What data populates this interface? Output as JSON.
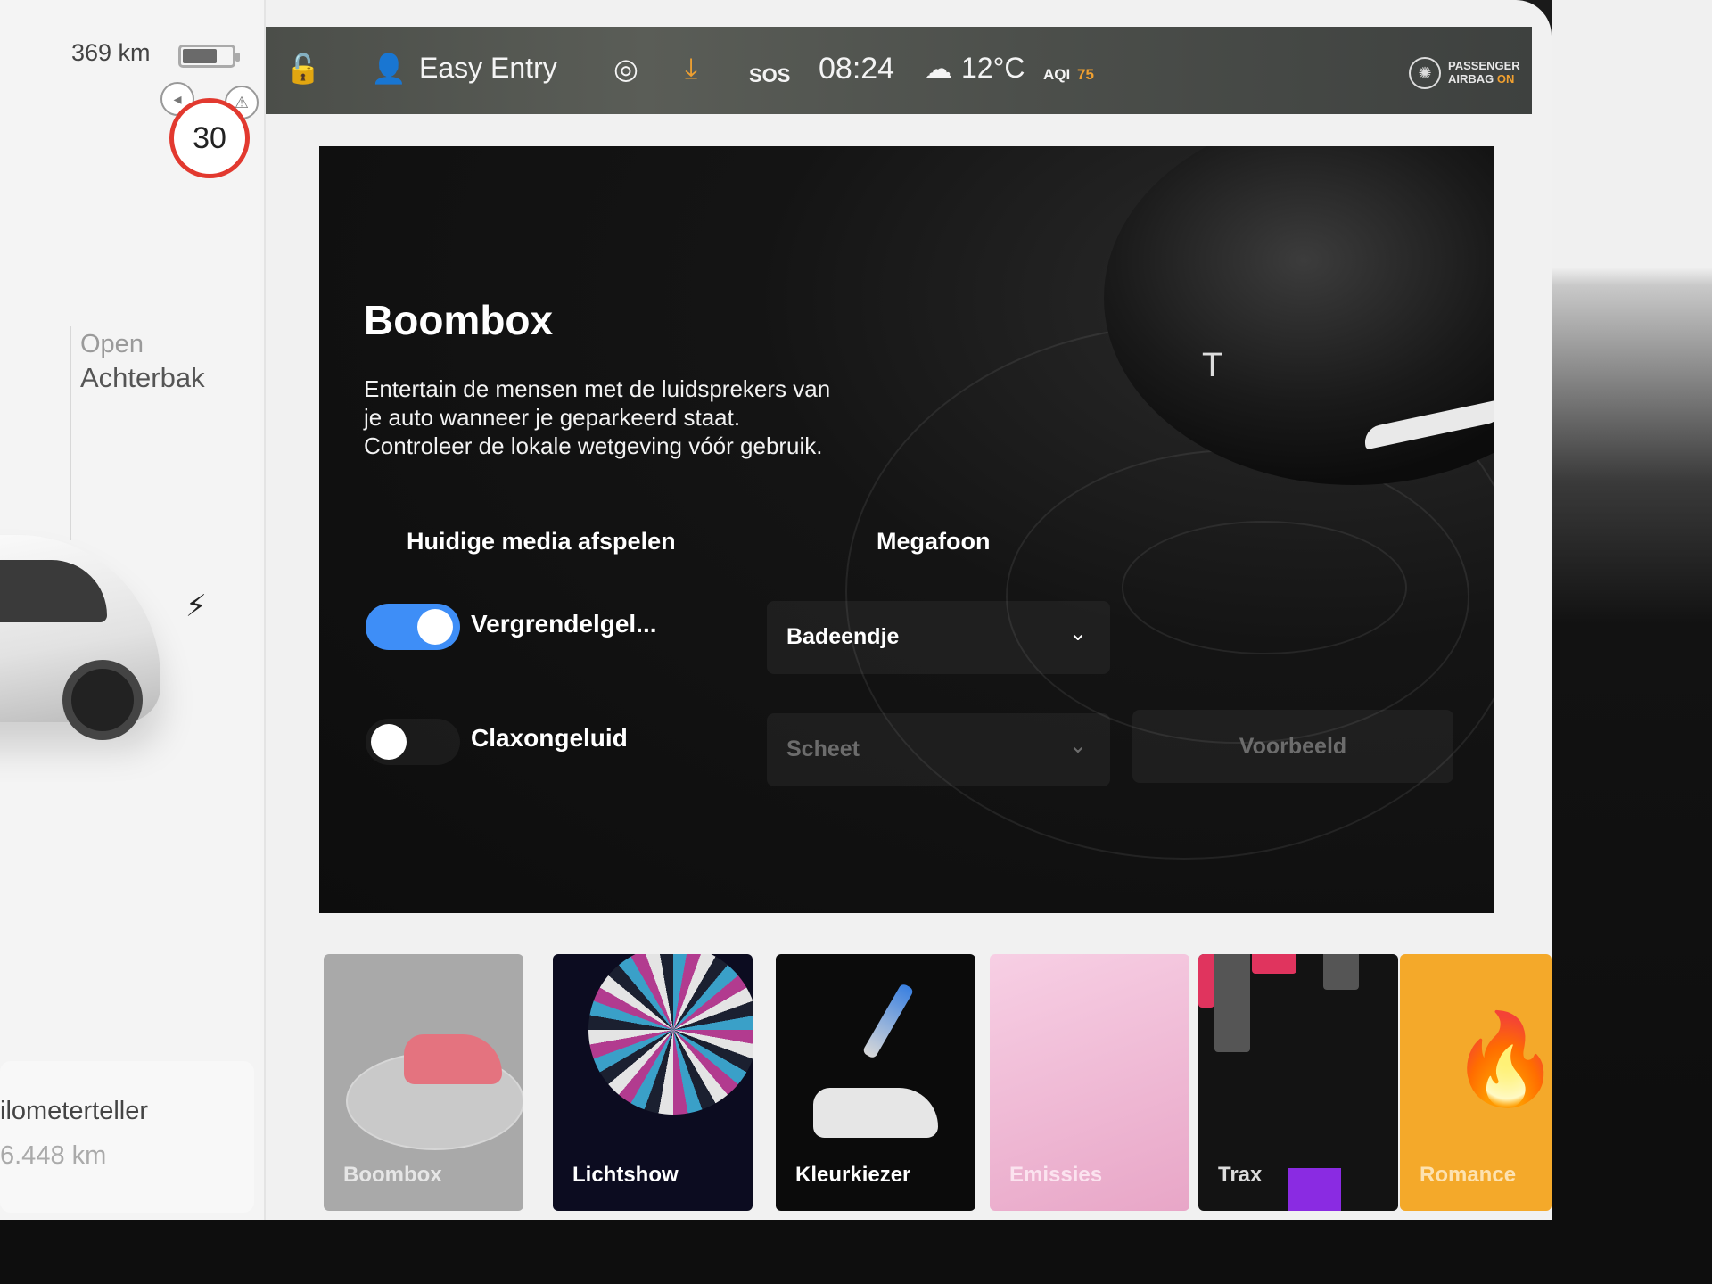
{
  "status": {
    "range": "369 km",
    "speed_limit": "30",
    "profile_name": "Easy Entry",
    "time": "08:24",
    "temperature": "12°C",
    "aqi_label": "AQI",
    "aqi_value": "75",
    "sos_label": "SOS",
    "airbag_line1": "PASSENGER",
    "airbag_line2": "AIRBAG",
    "airbag_state": "ON"
  },
  "car_pane": {
    "trunk_state": "Open",
    "trunk_name": "Achterbak",
    "odometer_label": "ilometerteller",
    "odometer_value": "6.448 km"
  },
  "boombox": {
    "title": "Boombox",
    "description_lines": [
      "Entertain de mensen met de luidsprekers van",
      "je auto wanneer je geparkeerd staat.",
      "Controleer de lokale wetgeving vóór gebruik."
    ],
    "tabs": [
      "Huidige media afspelen",
      "Megafoon"
    ],
    "lock_sound_label": "Vergrendelgel...",
    "lock_sound_enabled": true,
    "lock_sound_value": "Badeendje",
    "horn_sound_label": "Claxongeluid",
    "horn_sound_enabled": false,
    "horn_sound_value": "Scheet",
    "preview_label": "Voorbeeld"
  },
  "tiles": [
    "Boombox",
    "Lichtshow",
    "Kleurkiezer",
    "Emissies",
    "Trax",
    "Romance"
  ],
  "colors": {
    "accent": "#3e8ef7",
    "speed_sign_red": "#e2392f",
    "aqi_amber": "#f0a030"
  },
  "icons": [
    "lock-icon",
    "person-icon",
    "target-icon",
    "download-icon",
    "sos-icon",
    "weather-icon",
    "airbag-icon",
    "charge-icon",
    "chevron-down-icon",
    "tesla-logo-icon"
  ]
}
